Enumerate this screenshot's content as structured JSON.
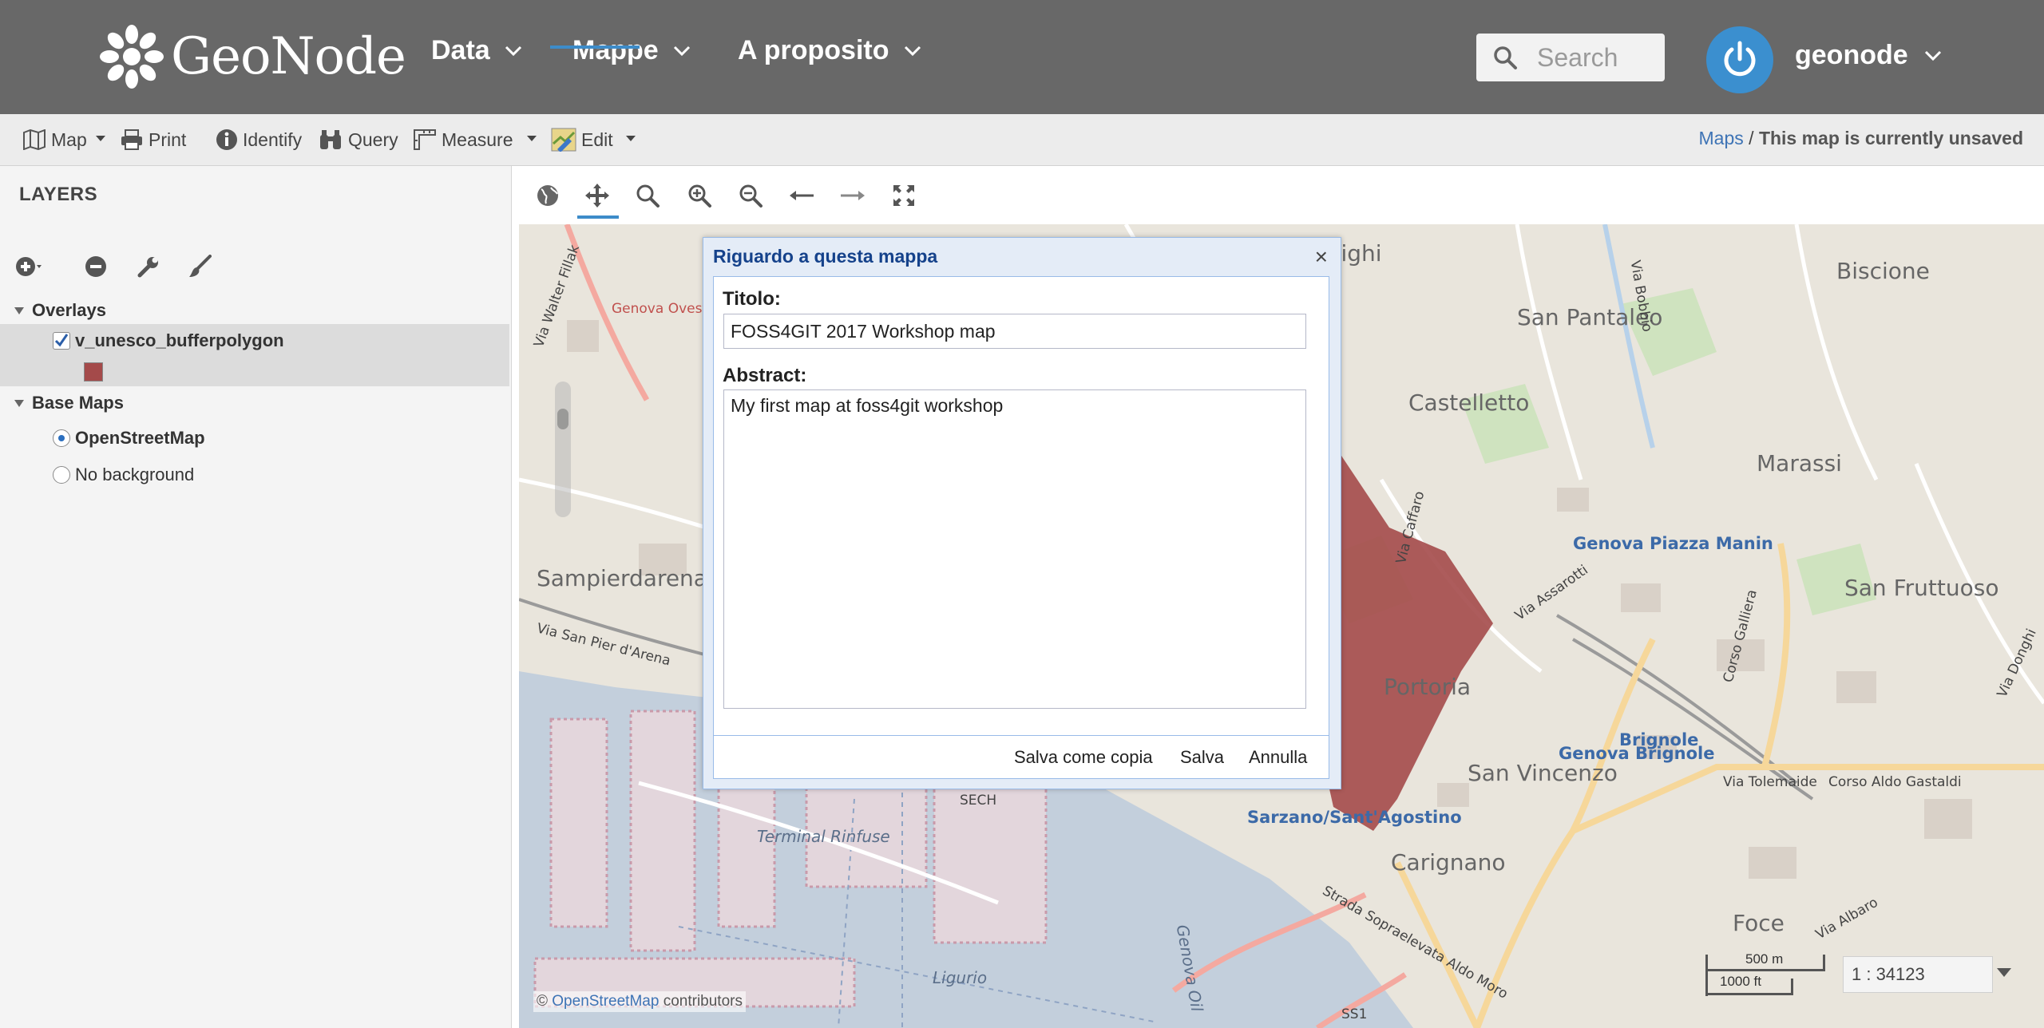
{
  "navbar": {
    "brand": "GeoNode",
    "menus": [
      {
        "label": "Data"
      },
      {
        "label": "Mappe"
      },
      {
        "label": "A proposito"
      }
    ],
    "search_placeholder": "Search",
    "user": "geonode"
  },
  "toolbar": {
    "map": "Map",
    "print": "Print",
    "identify": "Identify",
    "query": "Query",
    "measure": "Measure",
    "edit": "Edit",
    "breadcrumb_link": "Maps",
    "breadcrumb_sep": " / ",
    "breadcrumb_current": "This map is currently unsaved"
  },
  "layers": {
    "title": "LAYERS",
    "overlays_label": "Overlays",
    "overlay_layers": [
      {
        "name": "v_unesco_bufferpolygon",
        "checked": true,
        "legend_color": "#a44a4a"
      }
    ],
    "base_maps_label": "Base Maps",
    "base_maps": [
      {
        "name": "OpenStreetMap",
        "selected": true
      },
      {
        "name": "No background",
        "selected": false
      }
    ]
  },
  "map": {
    "labels": [
      "Righi",
      "Biscione",
      "San Pantaleo",
      "Castelletto",
      "Marassi",
      "Genova Piazza Manin",
      "San Fruttuoso",
      "Sampierdarena",
      "Portoria",
      "Brignole",
      "Genova Brignole",
      "San Vincenzo",
      "Sarzano/Sant'Agostino",
      "Carignano",
      "Foce",
      "Via Tolemaide",
      "Corso Aldo Gastaldi",
      "Via San Pier d'Arena",
      "Via Walter Fillak",
      "Genova Ovest",
      "Via Caffaro",
      "Via Assarotti",
      "Corso Galliera",
      "Via Bobbio",
      "Via Donghi",
      "Strada Sopraelevata Aldo Moro",
      "Via Albaro",
      "Terminal Rinfuse",
      "SECH",
      "Ligurio",
      "Genova Oil",
      "SS1"
    ],
    "attribution_prefix": "©",
    "attribution_link": "OpenStreetMap",
    "attribution_suffix": "contributors",
    "scale_top": "500 m",
    "scale_bottom": "1000 ft",
    "scale_ratio": "1 : 34123",
    "overlay_color": "#a44a4a"
  },
  "dialog": {
    "title": "Riguardo a questa mappa",
    "close": "×",
    "title_label": "Titolo:",
    "title_value": "FOSS4GIT 2017 Workshop map",
    "abstract_label": "Abstract:",
    "abstract_value": "My first map at foss4git workshop",
    "buttons": {
      "save_copy": "Salva come copia",
      "save": "Salva",
      "cancel": "Annulla"
    }
  }
}
